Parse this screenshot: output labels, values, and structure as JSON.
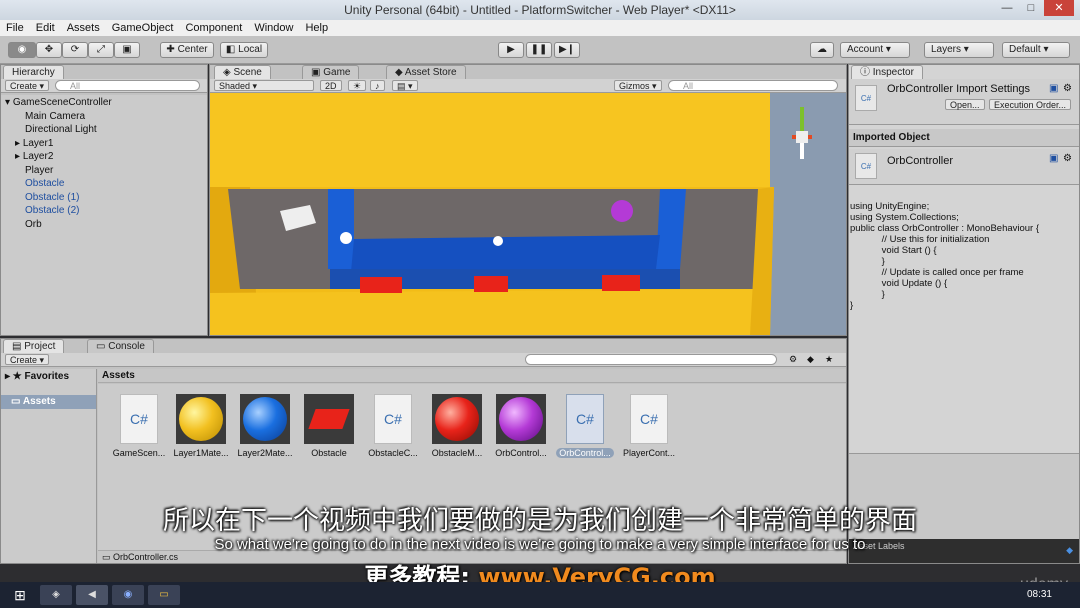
{
  "window": {
    "title": "Unity Personal (64bit) - Untitled - PlatformSwitcher - Web Player* <DX11>",
    "buttons": [
      "—",
      "□",
      "✕"
    ]
  },
  "menu": [
    "File",
    "Edit",
    "Assets",
    "GameObject",
    "Component",
    "Window",
    "Help"
  ],
  "toolbar": {
    "center_label": "Center",
    "local_label": "Local",
    "account_label": "Account",
    "layers_label": "Layers",
    "layout_label": "Default"
  },
  "hierarchy": {
    "tab": "Hierarchy",
    "create": "Create",
    "search_placeholder": "All",
    "root": "GameSceneController",
    "items": [
      {
        "label": "Main Camera",
        "prefab": false
      },
      {
        "label": "Directional Light",
        "prefab": false
      },
      {
        "label": "Layer1",
        "prefab": false
      },
      {
        "label": "Layer2",
        "prefab": false
      },
      {
        "label": "Player",
        "prefab": false
      },
      {
        "label": "Obstacle",
        "prefab": true
      },
      {
        "label": "Obstacle (1)",
        "prefab": true
      },
      {
        "label": "Obstacle (2)",
        "prefab": true
      },
      {
        "label": "Orb",
        "prefab": false
      }
    ]
  },
  "scene": {
    "tabs": [
      "Scene",
      "Game",
      "Asset Store"
    ],
    "shading": "Shaded",
    "mode2d": "2D",
    "gizmos": "Gizmos",
    "search_placeholder": "All"
  },
  "inspector": {
    "tab": "Inspector",
    "title": "OrbController Import Settings",
    "open_button": "Open...",
    "exec_button": "Execution Order...",
    "section": "Imported Object",
    "object_name": "OrbController",
    "code": [
      "using UnityEngine;",
      "using System.Collections;",
      "",
      "public class OrbController : MonoBehaviour {",
      "",
      "            // Use this for initialization",
      "            void Start () {",
      "",
      "            }",
      "",
      "            // Update is called once per frame",
      "            void Update () {",
      "",
      "            }",
      "}"
    ],
    "asset_labels": "Asset Labels"
  },
  "project": {
    "tabs": [
      "Project",
      "Console"
    ],
    "create": "Create",
    "favorites": "Favorites",
    "assets_folder": "Assets",
    "assets_header": "Assets",
    "selected_path": "OrbController.cs",
    "assets": [
      {
        "label": "GameScen...",
        "kind": "script"
      },
      {
        "label": "Layer1Mate...",
        "kind": "yellow"
      },
      {
        "label": "Layer2Mate...",
        "kind": "blue"
      },
      {
        "label": "Obstacle",
        "kind": "cube"
      },
      {
        "label": "ObstacleC...",
        "kind": "script"
      },
      {
        "label": "ObstacleM...",
        "kind": "red"
      },
      {
        "label": "OrbControl...",
        "kind": "purple"
      },
      {
        "label": "OrbControl...",
        "kind": "script-selected"
      },
      {
        "label": "PlayerCont...",
        "kind": "script"
      }
    ]
  },
  "subtitles": {
    "chinese": "所以在下一个视频中我们要做的是为我们创建一个非常简单的界面",
    "english": "So what we're going to do in the next video is we're going to make a very simple interface for us to",
    "promo_prefix": "更多教程: ",
    "promo_url": "www.VeryCG.com"
  },
  "watermark": "udemy",
  "taskbar": {
    "time": "08:31"
  },
  "colors": {
    "scene_yellow": "#f7c520",
    "scene_blue": "#1a5fd6",
    "obstacle_red": "#e8231a",
    "orb_purple": "#b43ad6"
  }
}
